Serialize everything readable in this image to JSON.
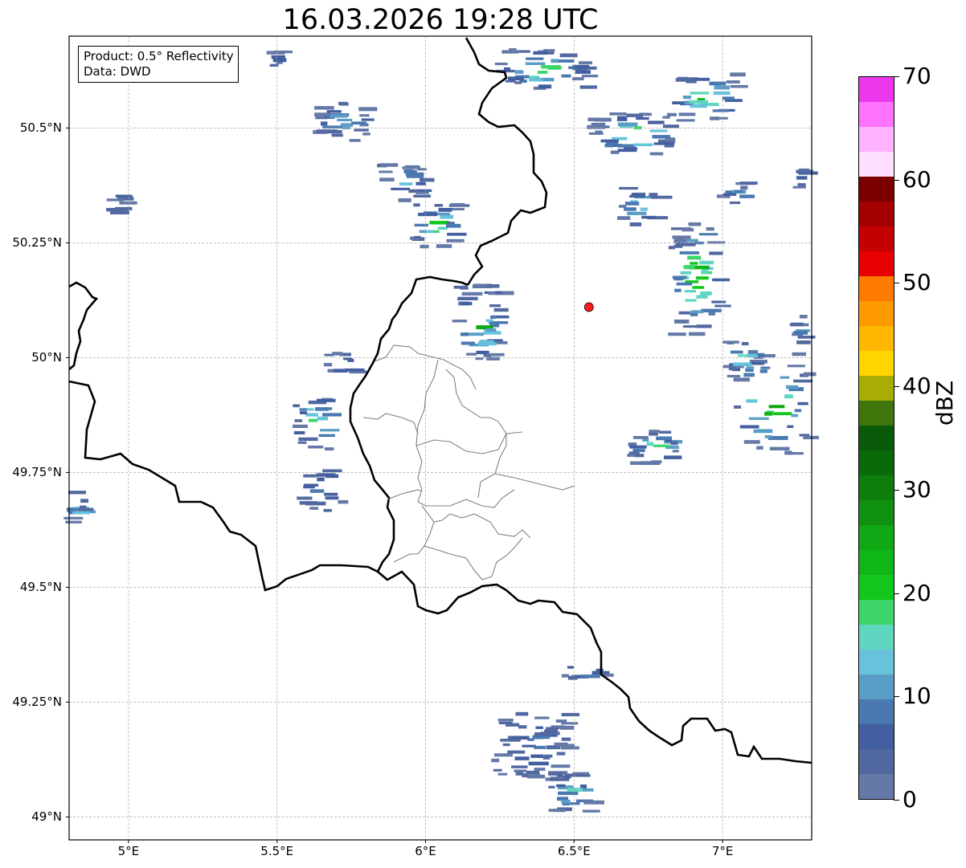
{
  "title": "16.03.2026 19:28 UTC",
  "info_box": {
    "product": "Product: 0.5° Reflectivity",
    "data_source": "Data: DWD"
  },
  "map": {
    "lon_range": [
      4.8,
      7.3
    ],
    "lat_range": [
      48.95,
      50.7
    ],
    "gridlines": true,
    "lon_ticks": [
      {
        "value": 5.0,
        "label": "5°E"
      },
      {
        "value": 5.5,
        "label": "5.5°E"
      },
      {
        "value": 6.0,
        "label": "6°E"
      },
      {
        "value": 6.5,
        "label": "6.5°E"
      },
      {
        "value": 7.0,
        "label": "7°E"
      }
    ],
    "lat_ticks": [
      {
        "value": 50.5,
        "label": "50.5°N"
      },
      {
        "value": 50.25,
        "label": "50.25°N"
      },
      {
        "value": 50.0,
        "label": "50°N"
      },
      {
        "value": 49.75,
        "label": "49.75°N"
      },
      {
        "value": 49.5,
        "label": "49.5°N"
      },
      {
        "value": 49.25,
        "label": "49.25°N"
      },
      {
        "value": 49.0,
        "label": "49°N"
      }
    ],
    "radar_site": {
      "lon": 6.55,
      "lat": 50.11,
      "color": "#ff1a1a"
    }
  },
  "colorbar": {
    "label": "dBZ",
    "range": [
      0,
      70
    ],
    "ticks": [
      0,
      10,
      20,
      30,
      40,
      50,
      60,
      70
    ],
    "tick_labels": [
      "0",
      "10",
      "20",
      "30",
      "40",
      "50",
      "60",
      "70"
    ],
    "colors": [
      "#6479a7",
      "#5268a0",
      "#435fa0",
      "#4a78b0",
      "#5a9dc6",
      "#67c3dc",
      "#5fd6c0",
      "#3ed66a",
      "#13c71c",
      "#10b618",
      "#10a814",
      "#0f9010",
      "#0d7d0d",
      "#0a6a0a",
      "#095b09",
      "#3f760c",
      "#a8ad03",
      "#ffd500",
      "#ffb700",
      "#ff9a00",
      "#ff7c00",
      "#e60000",
      "#c40000",
      "#a30000",
      "#7d0000",
      "#ffdfff",
      "#ffb2ff",
      "#ff73ff",
      "#ec38ec"
    ]
  }
}
